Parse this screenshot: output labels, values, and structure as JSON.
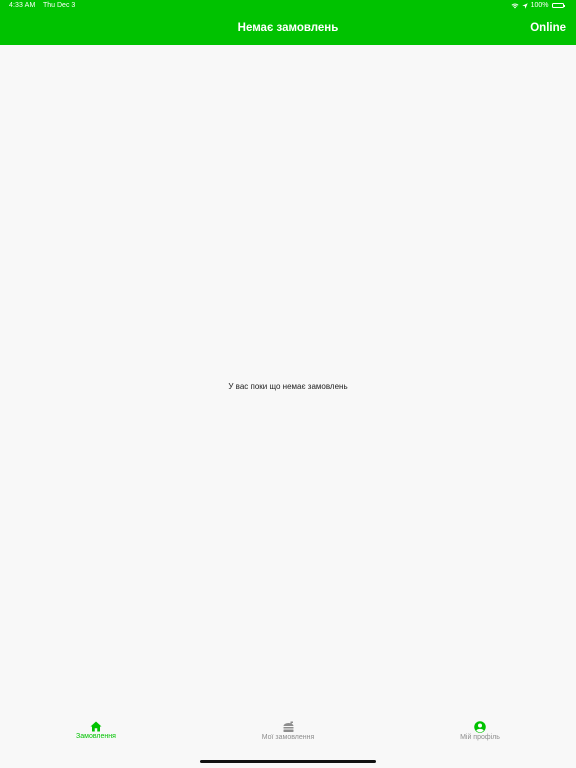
{
  "status_bar": {
    "time": "4:33 AM",
    "date": "Thu Dec 3",
    "battery": "100%",
    "icons": [
      "wifi-icon",
      "location-arrow-icon",
      "battery-icon"
    ]
  },
  "header": {
    "title": "Немає замовлень",
    "status_label": "Online"
  },
  "main": {
    "empty_message": "У вас поки що немає замовлень"
  },
  "tabbar": {
    "tabs": [
      {
        "label": "Замовлення",
        "icon": "home-icon",
        "active": true
      },
      {
        "label": "Мої замовлення",
        "icon": "orders-icon",
        "active": false
      },
      {
        "label": "Мій профіль",
        "icon": "profile-icon",
        "active": false
      }
    ]
  },
  "colors": {
    "accent": "#00c200",
    "background": "#f8f8f8",
    "inactive": "#8e8e8e"
  }
}
